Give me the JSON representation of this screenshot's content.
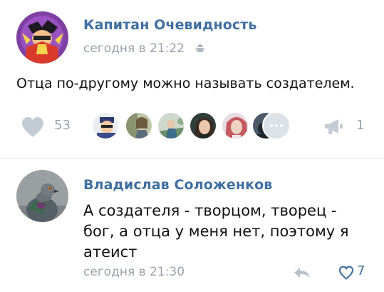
{
  "post": {
    "author": "Капитан Очевидность",
    "timestamp": "сегодня в 21:22",
    "text": "Отца по-другому можно называть создателем.",
    "likes": "53",
    "shares": "1"
  },
  "comment": {
    "author": "Владислав Соложенков",
    "text_lines": [
      "А создателя - творцом, творец -",
      "бог, а отца у меня нет, поэтому я",
      "атеист"
    ],
    "timestamp": "сегодня в 21:30",
    "likes": "7"
  },
  "colors": {
    "author": "#3f6f9f",
    "meta": "#9aa3ad",
    "like_active": "#3f6f9f",
    "like_inactive": "#c3ccd5"
  }
}
